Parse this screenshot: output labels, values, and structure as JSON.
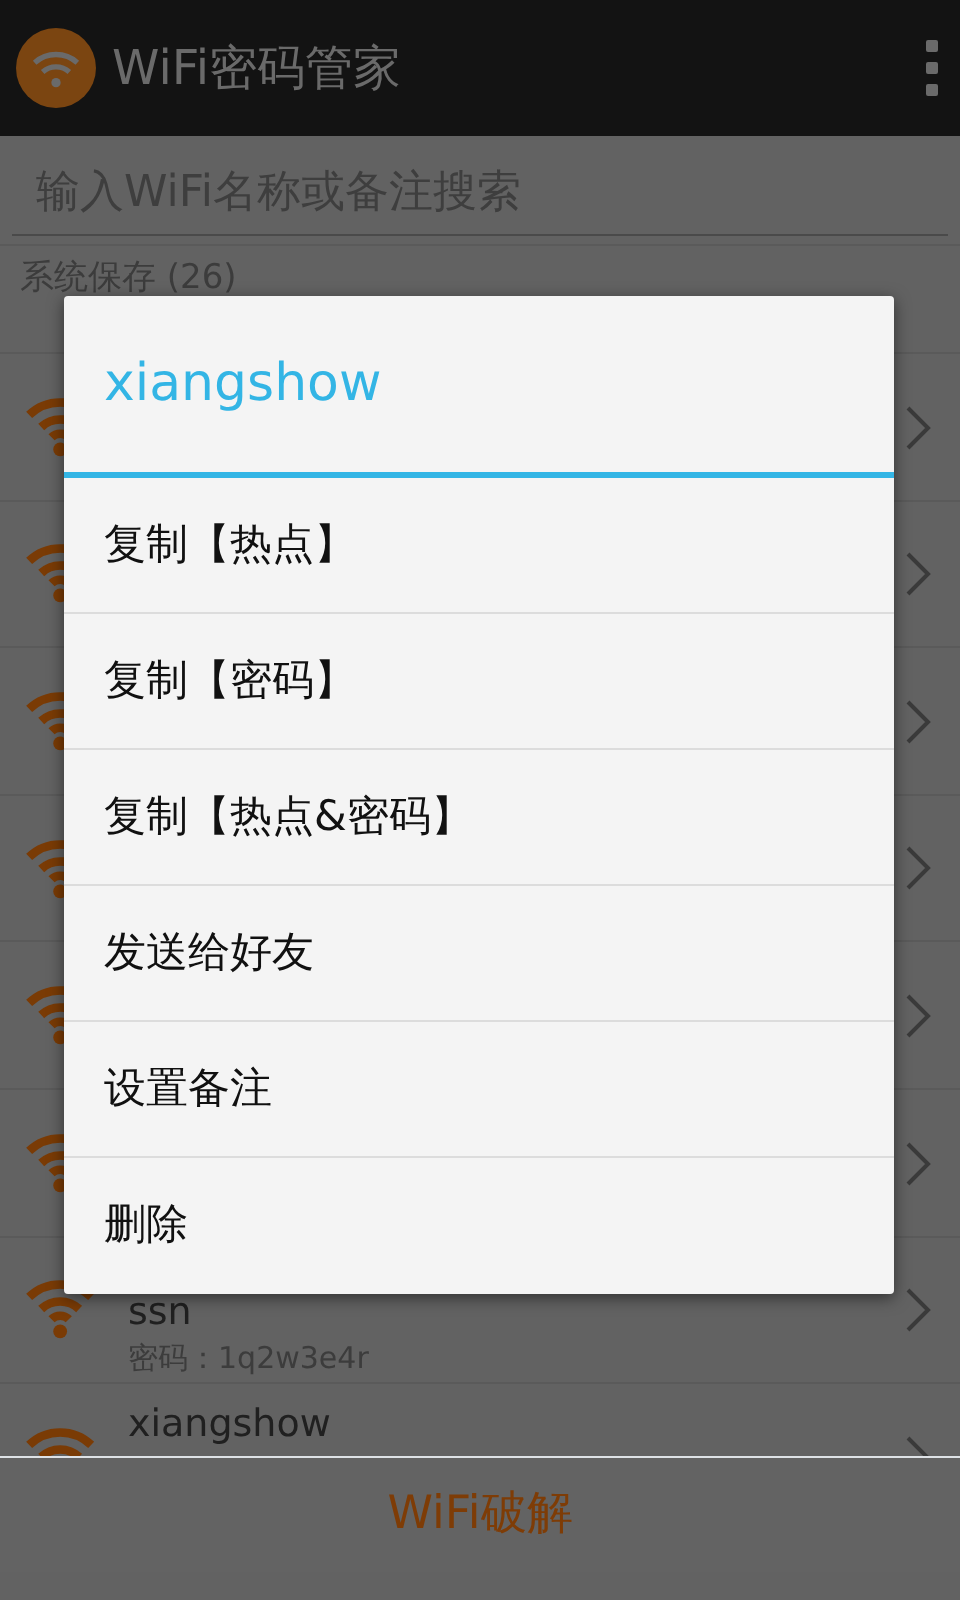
{
  "app_bar": {
    "title": "WiFi密码管家"
  },
  "search": {
    "placeholder": "输入WiFi名称或备注搜索"
  },
  "section": {
    "title": "系统保存 (26)"
  },
  "networks": [
    {
      "kind": "covered"
    },
    {
      "kind": "covered"
    },
    {
      "kind": "covered"
    },
    {
      "kind": "covered"
    },
    {
      "kind": "covered"
    },
    {
      "kind": "covered"
    },
    {
      "kind": "shown",
      "name": "ssn",
      "password": "密码：1q2w3e4r"
    },
    {
      "kind": "shown",
      "name": "xiangshow"
    }
  ],
  "dialog": {
    "title": "xiangshow",
    "items": [
      "复制【热点】",
      "复制【密码】",
      "复制【热点&密码】",
      "发送给好友",
      "设置备注",
      "删除"
    ]
  },
  "bottom_bar": {
    "label": "WiFi破解"
  }
}
